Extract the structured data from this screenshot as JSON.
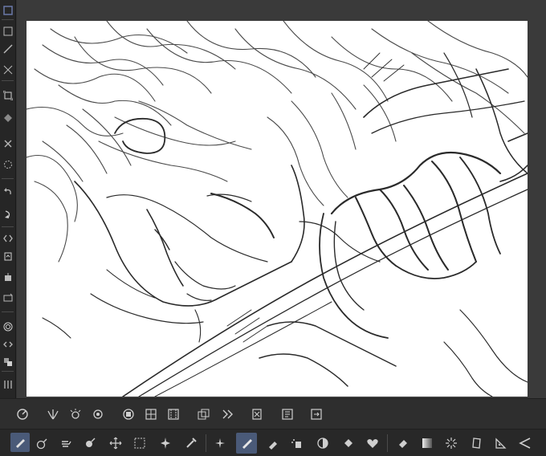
{
  "app": {
    "colors": {
      "ui_dark": "#262626",
      "ui_panel": "#2e2e2e",
      "icon": "#c8c8c8",
      "active": "#4a5a78",
      "canvas": "#ffffff",
      "ink": "#2a2a2a"
    }
  },
  "left_toolbar": {
    "icons": [
      "select-rect-icon",
      "grid-icon",
      "ruler-icon",
      "transform-icon",
      "eraser-icon",
      "fill-icon",
      "clear-icon",
      "undo-icon",
      "redo-icon",
      "flip-icon",
      "layer-icon",
      "export-icon",
      "view-icon",
      "spiral-icon",
      "code-icon",
      "layers-stack-icon",
      "timeline-icon"
    ]
  },
  "command_bar": {
    "icons": [
      "settings-dial-icon",
      "symmetry-icon",
      "gear-stars-icon",
      "target-icon",
      "layer-circle-icon",
      "grid-window-icon",
      "film-strip-icon",
      "stack-arrows-icon",
      "double-chevron-icon",
      "delete-layer-icon",
      "layer-list-icon",
      "import-icon"
    ]
  },
  "tool_bar": {
    "active_tool": "pen-tool",
    "icons": [
      "pencil-icon",
      "lasso-icon",
      "hand-icon",
      "eyedropper-icon",
      "move-icon",
      "rect-select-icon",
      "magic-wand-icon",
      "dropper-icon",
      "sparkle-icon",
      "pen-icon",
      "marker-icon",
      "airbrush-icon",
      "blend-icon",
      "fill-bucket-icon",
      "heart-shape-icon",
      "eraser-tool-icon",
      "gradient-icon",
      "ray-icon",
      "frame-icon",
      "ruler-triangle-icon",
      "text-shape-icon"
    ]
  }
}
